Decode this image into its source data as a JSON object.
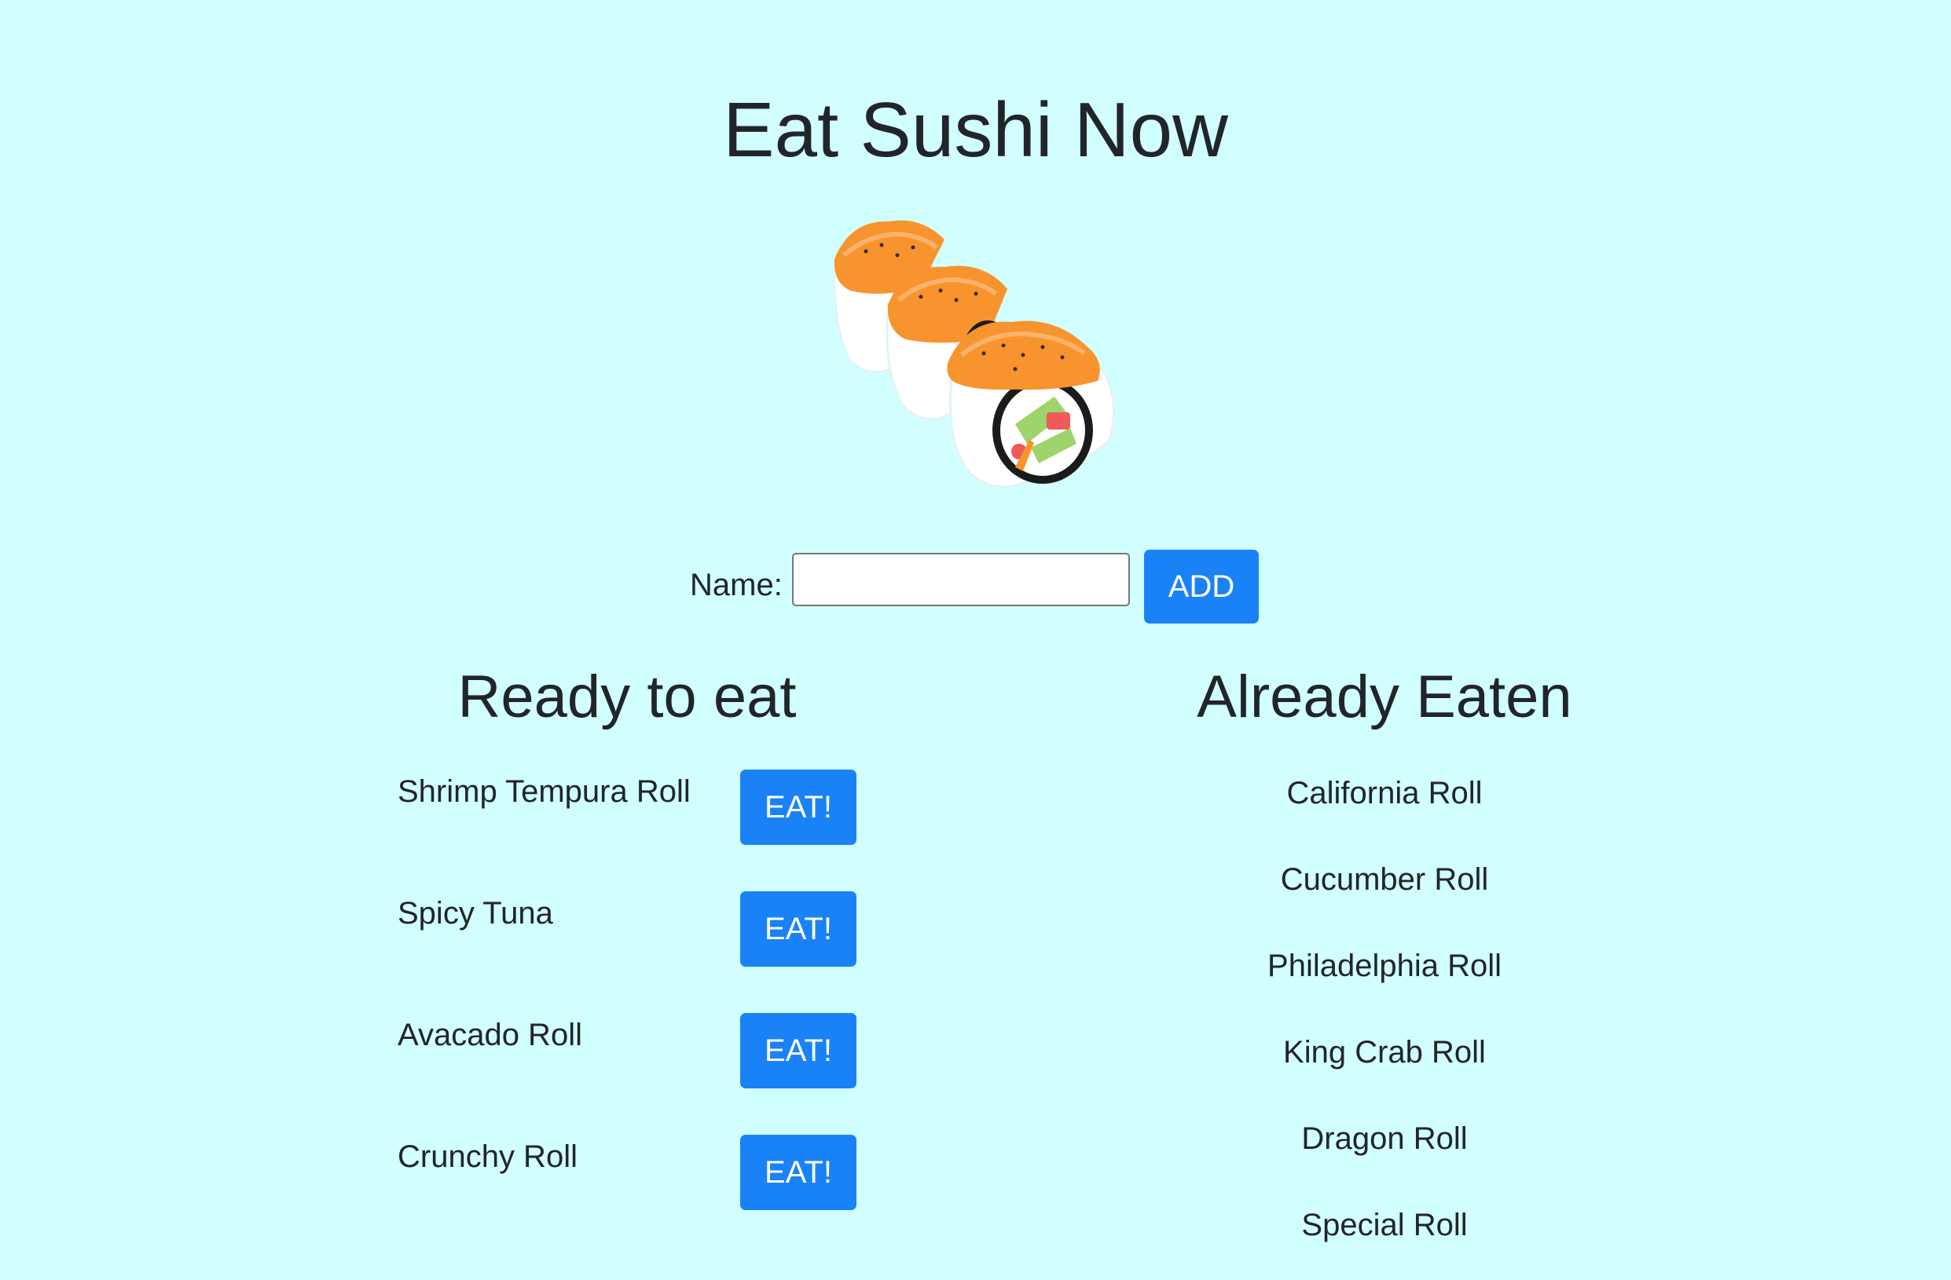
{
  "header": {
    "title": "Eat Sushi Now"
  },
  "hero_image": {
    "icon": "sushi-rolls-illustration",
    "colors": {
      "salmon": "#f7942e",
      "rice": "#ffffff",
      "nori": "#1b1b1b",
      "cucumber": "#9fd36b",
      "tuna": "#ef5a5a"
    }
  },
  "form": {
    "name_label": "Name:",
    "name_value": "",
    "add_label": "ADD"
  },
  "ready": {
    "heading": "Ready to eat",
    "items": [
      {
        "name": "Shrimp Tempura Roll",
        "button": "EAT!"
      },
      {
        "name": "Spicy Tuna",
        "button": "EAT!"
      },
      {
        "name": "Avacado Roll",
        "button": "EAT!"
      },
      {
        "name": "Crunchy Roll",
        "button": "EAT!"
      }
    ]
  },
  "eaten": {
    "heading": "Already Eaten",
    "items": [
      "California Roll",
      "Cucumber Roll",
      "Philadelphia Roll",
      "King Crab Roll",
      "Dragon Roll",
      "Special Roll"
    ]
  },
  "colors": {
    "background": "#d1ffff",
    "primary": "#1a82f7",
    "text": "#212529"
  }
}
